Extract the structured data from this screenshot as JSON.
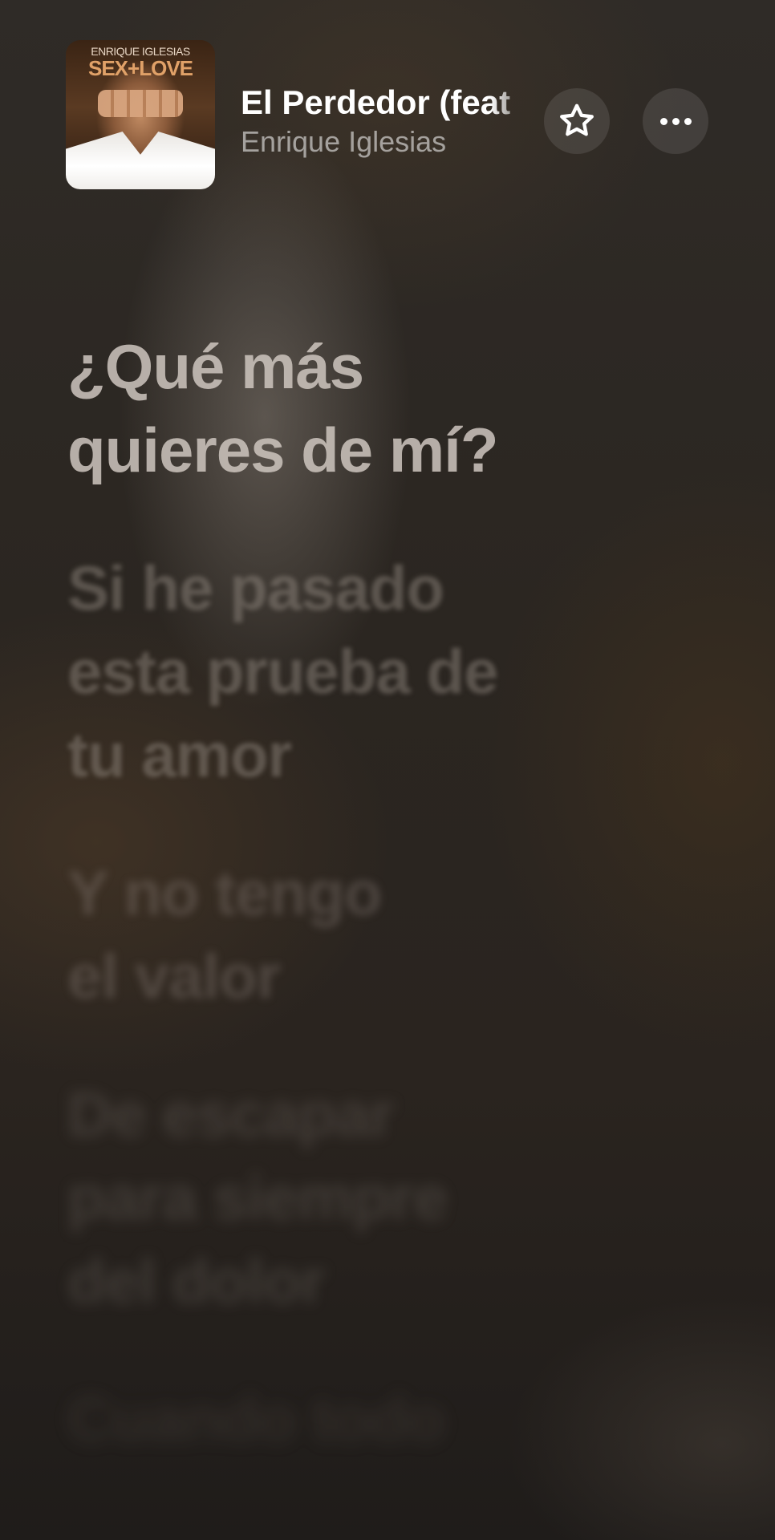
{
  "now_playing": {
    "title": "El Perdedor (feat",
    "artist": "Enrique Iglesias",
    "artwork": {
      "artist_text": "ENRIQUE IGLESIAS",
      "album_text": "SEX+LOVE"
    }
  },
  "actions": {
    "favorite_icon": "star-outline-icon",
    "more_icon": "ellipsis-icon"
  },
  "lyrics": {
    "lines": [
      "¿Qué más\nquieres de mí?",
      "Si he pasado\nesta prueba de\ntu amor",
      "Y no tengo\nel valor",
      "De escapar\npara siempre\ndel dolor",
      "Cuando todo"
    ]
  },
  "colors": {
    "text_primary": "#ffffff",
    "text_secondary": "rgba(255,255,255,0.55)",
    "background": "#2a2622"
  }
}
